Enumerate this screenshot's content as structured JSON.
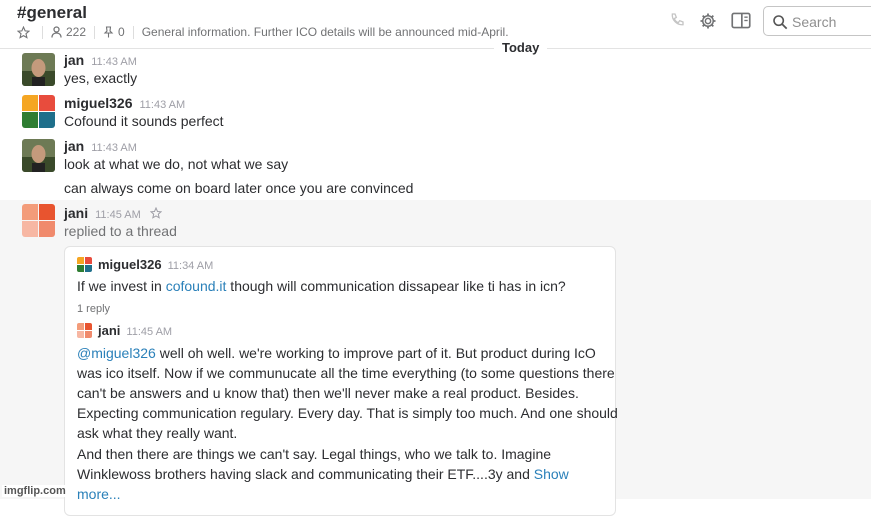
{
  "header": {
    "channel": "#general",
    "members": "222",
    "pins": "0",
    "topic": "General information. Further ICO details will be announced mid-April.",
    "search_placeholder": "Search"
  },
  "day_divider": "Today",
  "messages": [
    {
      "author": "jan",
      "time": "11:43 AM",
      "text": "yes, exactly"
    },
    {
      "author": "miguel326",
      "time": "11:43 AM",
      "text": "Cofound it sounds perfect"
    },
    {
      "author": "jan",
      "time": "11:43 AM",
      "text": "look at what we do, not what we say",
      "text2": "can always come on board later once you are convinced"
    },
    {
      "author": "jani",
      "time": "11:45 AM",
      "text": "replied to a thread"
    }
  ],
  "thread": {
    "parent_author": "miguel326",
    "parent_time": "11:34 AM",
    "parent_text_before": "If we invest in ",
    "parent_link": "cofound.it",
    "parent_text_after": " though will communication dissapear like ti has in icn?",
    "reply_count": "1 reply",
    "reply_author": "jani",
    "reply_time": "11:45 AM",
    "mention": "@miguel326",
    "reply_lines": [
      " well oh well. we're working to improve part of it. But product during IcO",
      "was ico itself. Now if we communucate all the time everything (to some questions there",
      "can't be answers and u know that) then we'll never make a real product. Besides.",
      "Expecting communication regulary. Every day. That is simply too much. And one should",
      "ask what they really want.",
      "And then there are things we can't say. Legal things, who we talk to. Imagine",
      "Winklewoss brothers having slack and communicating their ETF....3y and "
    ],
    "show_more_1": "Show",
    "show_more_2": "more..."
  },
  "watermark": "imgflip.com",
  "colors": {
    "link": "#2a80b9",
    "highlight_bg": "#f6f6f6"
  }
}
